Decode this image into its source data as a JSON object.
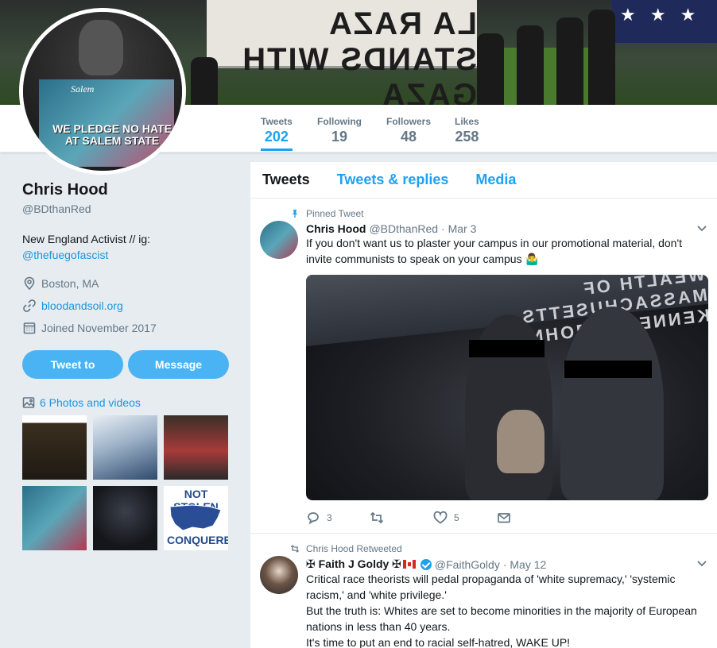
{
  "banner": {
    "sign_text": "LA RAZA STANDS WITH GAZA"
  },
  "avatar": {
    "poster_text": "WE PLEDGE NO HATE AT SALEM STATE",
    "sign_text": "Salem"
  },
  "stats": [
    {
      "label": "Tweets",
      "value": "202"
    },
    {
      "label": "Following",
      "value": "19"
    },
    {
      "label": "Followers",
      "value": "48"
    },
    {
      "label": "Likes",
      "value": "258"
    }
  ],
  "profile": {
    "name": "Chris Hood",
    "handle": "@BDthanRed",
    "bio_text": "New England Activist // ig:",
    "bio_link": "@thefuegofascist",
    "location": "Boston, MA",
    "website": "bloodandsoil.org",
    "joined": "Joined November 2017",
    "tweet_to_label": "Tweet to",
    "message_label": "Message",
    "photos_label": "6 Photos and videos",
    "thumb_caption_top": "NOT STOLEN",
    "thumb_caption_bottom": "CONQUERED"
  },
  "tabs": [
    "Tweets",
    "Tweets & replies",
    "Media"
  ],
  "tweets": [
    {
      "context": "Pinned Tweet",
      "name": "Chris Hood",
      "handle": "@BDthanRed",
      "date": "· Mar 3",
      "text": "If you don't want us to plaster your campus in our promotional material, don't invite communists to speak on your campus 🤷‍♂️",
      "media_text": "WEALTH OF MASSACHUSETTS · KENNEDY · JOHN",
      "replies": "3",
      "retweets": "",
      "likes": "5"
    },
    {
      "context": "Chris Hood Retweeted",
      "name_prefix": "✠ Faith J Goldy ✠",
      "handle": "@FaithGoldy",
      "date": "· May 12",
      "lines": [
        "Critical race theorists will pedal propaganda of 'white supremacy,' 'systemic racism,' and 'white privilege.'",
        "But the truth is: Whites are set to become minorities in the majority of European nations in less than 40 years.",
        "It's time to put an end to racial self-hatred, WAKE UP!"
      ]
    }
  ],
  "colors": {
    "accent": "#1da1f2",
    "link": "#1b95e0",
    "button": "#4ab3f4",
    "background": "#e6ecf0"
  }
}
